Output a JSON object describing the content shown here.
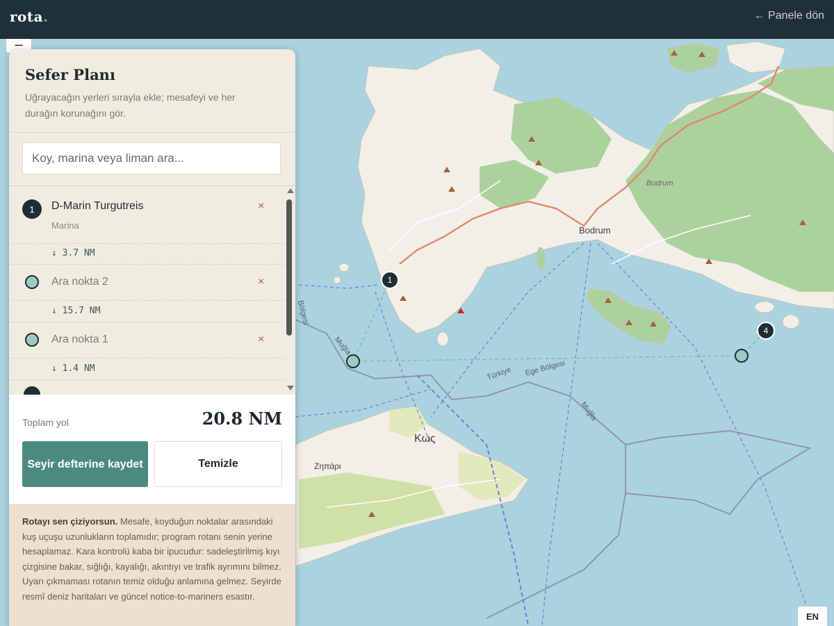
{
  "app": {
    "logo": "rota",
    "back_link": "← Panele dön"
  },
  "map": {
    "labels": {
      "bodrum_city": "Bodrum",
      "bodrum_italic": "Bodrum",
      "kos": "Κως",
      "zipari": "Ζηπάρι",
      "turkiye": "Türkiye",
      "ege_bolgesi": "Ege Bölgesi",
      "mugla_right": "Muğla",
      "mugla_left": "Muğla",
      "bolgesi_left": "Bölgesi"
    },
    "markers": [
      {
        "label": "1"
      },
      {
        "label": "4"
      }
    ],
    "colors": {
      "sea": "#aad3df",
      "land": "#f2efe9",
      "forest": "#add19e",
      "route": "#e08a6a"
    }
  },
  "panel": {
    "title": "Sefer Planı",
    "description": "Uğrayacağın yerleri sırayla ekle; mesafeyi ve her durağın korunağını gör.",
    "search_placeholder": "Koy, marina veya liman ara...",
    "stops": [
      {
        "number": "1",
        "name": "D-Marin Turgutreis",
        "type": "Marina",
        "remove": "×"
      },
      {
        "name": "Ara nokta 2",
        "remove": "×"
      },
      {
        "name": "Ara nokta 1",
        "remove": "×"
      }
    ],
    "distances": [
      "↓ 3.7 NM",
      "↓ 15.7 NM",
      "↓ 1.4 NM"
    ],
    "total_label": "Toplam yol",
    "total_value": "20.8 NM",
    "save_label": "Seyir defterine kaydet",
    "clear_label": "Temizle",
    "note_bold": "Rotayı sen çiziyorsun.",
    "note_text": " Mesafe, koyduğun noktalar arasındaki kuş uçuşu uzunlukların toplamıdır; program rotanı senin yerine hesaplamaz. Kara kontrolü kaba bir ipucudur: sadeleştirilmiş kıyı çizgisine bakar, sığlığı, kayalığı, akıntıyı ve trafik ayrımını bilmez. Uyarı çıkmaması rotanın temiz olduğu anlamına gelmez. Seyirde resmî deniz haritaları ve güncel notice-to-mariners esastır."
  },
  "lang": "EN",
  "zoom_minus": "−"
}
